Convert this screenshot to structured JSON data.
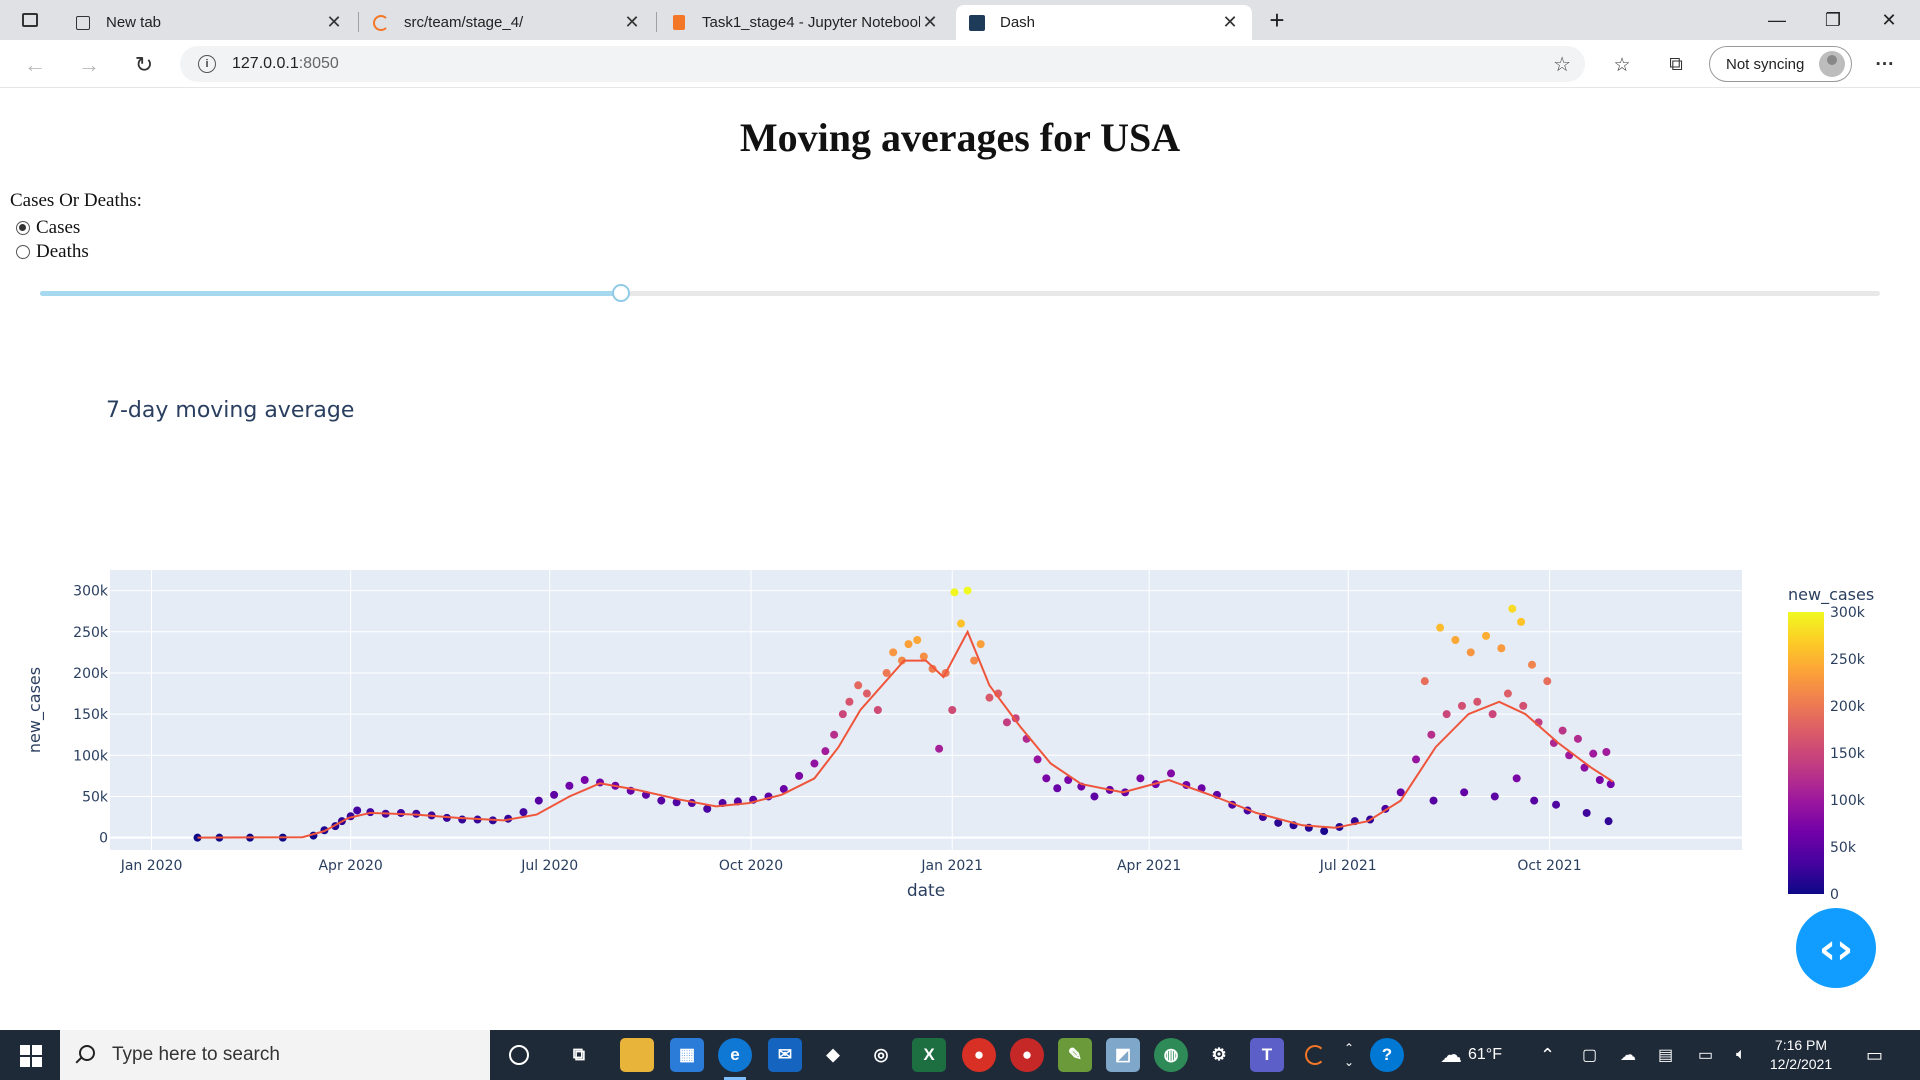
{
  "browser": {
    "tabs": [
      {
        "title": "New tab",
        "icon": "new-tab-icon"
      },
      {
        "title": "src/team/stage_4/",
        "icon": "jupyter-icon"
      },
      {
        "title": "Task1_stage4 - Jupyter Notebook",
        "icon": "notebook-icon"
      },
      {
        "title": "Dash",
        "icon": "dash-icon"
      }
    ],
    "active_tab": 3,
    "url_host": "127.0.0.1",
    "url_port": ":8050",
    "sync_label": "Not syncing"
  },
  "page": {
    "title": "Moving averages for USA",
    "radio_label": "Cases Or Deaths:",
    "options": [
      {
        "label": "Cases",
        "selected": true
      },
      {
        "label": "Deaths",
        "selected": false
      }
    ],
    "slider_fraction": 0.316,
    "chart_title": "7-day moving average"
  },
  "chart_data": {
    "type": "scatter",
    "title": "7-day moving average",
    "xlabel": "date",
    "ylabel": "new_cases",
    "x_ticks": [
      "Jan 2020",
      "Apr 2020",
      "Jul 2020",
      "Oct 2020",
      "Jan 2021",
      "Apr 2021",
      "Jul 2021",
      "Oct 2021"
    ],
    "y_ticks": [
      "0",
      "50k",
      "100k",
      "150k",
      "200k",
      "250k",
      "300k"
    ],
    "ylim": [
      -15000,
      325000
    ],
    "colorbar_title": "new_cases",
    "colorbar_ticks": [
      "0",
      "50k",
      "100k",
      "150k",
      "200k",
      "250k",
      "300k"
    ],
    "colors": {
      "line": "#ef553b",
      "plot_bg": "#e5ecf6"
    },
    "series": [
      {
        "kind": "markers",
        "points": [
          [
            "2020-01-22",
            0
          ],
          [
            "2020-02-01",
            0
          ],
          [
            "2020-02-15",
            0
          ],
          [
            "2020-03-01",
            10
          ],
          [
            "2020-03-15",
            2500
          ],
          [
            "2020-03-20",
            9000
          ],
          [
            "2020-03-25",
            14000
          ],
          [
            "2020-03-28",
            20000
          ],
          [
            "2020-04-01",
            26000
          ],
          [
            "2020-04-04",
            33000
          ],
          [
            "2020-04-10",
            31000
          ],
          [
            "2020-04-17",
            29000
          ],
          [
            "2020-04-24",
            30000
          ],
          [
            "2020-05-01",
            29000
          ],
          [
            "2020-05-08",
            27000
          ],
          [
            "2020-05-15",
            24000
          ],
          [
            "2020-05-22",
            22000
          ],
          [
            "2020-05-29",
            22000
          ],
          [
            "2020-06-05",
            21000
          ],
          [
            "2020-06-12",
            23000
          ],
          [
            "2020-06-19",
            31000
          ],
          [
            "2020-06-26",
            45000
          ],
          [
            "2020-07-03",
            52000
          ],
          [
            "2020-07-10",
            63000
          ],
          [
            "2020-07-17",
            70000
          ],
          [
            "2020-07-24",
            67000
          ],
          [
            "2020-07-31",
            63000
          ],
          [
            "2020-08-07",
            57000
          ],
          [
            "2020-08-14",
            52000
          ],
          [
            "2020-08-21",
            45000
          ],
          [
            "2020-08-28",
            43000
          ],
          [
            "2020-09-04",
            42000
          ],
          [
            "2020-09-11",
            35000
          ],
          [
            "2020-09-18",
            42000
          ],
          [
            "2020-09-25",
            44000
          ],
          [
            "2020-10-02",
            46000
          ],
          [
            "2020-10-09",
            50000
          ],
          [
            "2020-10-16",
            59000
          ],
          [
            "2020-10-23",
            75000
          ],
          [
            "2020-10-30",
            90000
          ],
          [
            "2020-11-04",
            105000
          ],
          [
            "2020-11-08",
            125000
          ],
          [
            "2020-11-12",
            150000
          ],
          [
            "2020-11-15",
            165000
          ],
          [
            "2020-11-19",
            185000
          ],
          [
            "2020-11-23",
            175000
          ],
          [
            "2020-11-28",
            155000
          ],
          [
            "2020-12-02",
            200000
          ],
          [
            "2020-12-05",
            225000
          ],
          [
            "2020-12-09",
            215000
          ],
          [
            "2020-12-12",
            235000
          ],
          [
            "2020-12-16",
            240000
          ],
          [
            "2020-12-19",
            220000
          ],
          [
            "2020-12-23",
            205000
          ],
          [
            "2020-12-26",
            108000
          ],
          [
            "2020-12-29",
            200000
          ],
          [
            "2021-01-01",
            155000
          ],
          [
            "2021-01-02",
            298000
          ],
          [
            "2021-01-05",
            260000
          ],
          [
            "2021-01-08",
            300000
          ],
          [
            "2021-01-11",
            215000
          ],
          [
            "2021-01-14",
            235000
          ],
          [
            "2021-01-18",
            170000
          ],
          [
            "2021-01-22",
            175000
          ],
          [
            "2021-01-26",
            140000
          ],
          [
            "2021-01-30",
            145000
          ],
          [
            "2021-02-04",
            120000
          ],
          [
            "2021-02-09",
            95000
          ],
          [
            "2021-02-13",
            72000
          ],
          [
            "2021-02-18",
            60000
          ],
          [
            "2021-02-23",
            70000
          ],
          [
            "2021-03-01",
            62000
          ],
          [
            "2021-03-07",
            50000
          ],
          [
            "2021-03-14",
            58000
          ],
          [
            "2021-03-21",
            55000
          ],
          [
            "2021-03-28",
            72000
          ],
          [
            "2021-04-04",
            65000
          ],
          [
            "2021-04-11",
            78000
          ],
          [
            "2021-04-18",
            64000
          ],
          [
            "2021-04-25",
            60000
          ],
          [
            "2021-05-02",
            52000
          ],
          [
            "2021-05-09",
            40000
          ],
          [
            "2021-05-16",
            33000
          ],
          [
            "2021-05-23",
            25000
          ],
          [
            "2021-05-30",
            18000
          ],
          [
            "2021-06-06",
            15000
          ],
          [
            "2021-06-13",
            12000
          ],
          [
            "2021-06-20",
            8000
          ],
          [
            "2021-06-27",
            13000
          ],
          [
            "2021-07-04",
            20000
          ],
          [
            "2021-07-11",
            22000
          ],
          [
            "2021-07-18",
            35000
          ],
          [
            "2021-07-25",
            55000
          ],
          [
            "2021-08-01",
            95000
          ],
          [
            "2021-08-08",
            125000
          ],
          [
            "2021-08-15",
            150000
          ],
          [
            "2021-08-22",
            160000
          ],
          [
            "2021-08-29",
            165000
          ],
          [
            "2021-09-05",
            150000
          ],
          [
            "2021-09-12",
            175000
          ],
          [
            "2021-09-19",
            160000
          ],
          [
            "2021-09-26",
            140000
          ],
          [
            "2021-10-03",
            115000
          ],
          [
            "2021-10-10",
            100000
          ],
          [
            "2021-10-17",
            85000
          ],
          [
            "2021-10-24",
            70000
          ],
          [
            "2021-10-29",
            65000
          ],
          [
            "2021-08-05",
            190000
          ],
          [
            "2021-08-12",
            255000
          ],
          [
            "2021-08-19",
            240000
          ],
          [
            "2021-08-26",
            225000
          ],
          [
            "2021-09-02",
            245000
          ],
          [
            "2021-09-09",
            230000
          ],
          [
            "2021-09-14",
            278000
          ],
          [
            "2021-09-18",
            262000
          ],
          [
            "2021-09-23",
            210000
          ],
          [
            "2021-09-30",
            190000
          ],
          [
            "2021-10-07",
            130000
          ],
          [
            "2021-10-14",
            120000
          ],
          [
            "2021-10-21",
            102000
          ],
          [
            "2021-10-27",
            104000
          ],
          [
            "2021-08-09",
            45000
          ],
          [
            "2021-08-23",
            55000
          ],
          [
            "2021-09-06",
            50000
          ],
          [
            "2021-09-16",
            72000
          ],
          [
            "2021-09-24",
            45000
          ],
          [
            "2021-10-04",
            40000
          ],
          [
            "2021-10-18",
            30000
          ],
          [
            "2021-10-28",
            20000
          ]
        ]
      },
      {
        "kind": "line",
        "points": [
          [
            "2020-01-22",
            0
          ],
          [
            "2020-03-10",
            500
          ],
          [
            "2020-03-20",
            8000
          ],
          [
            "2020-03-31",
            24000
          ],
          [
            "2020-04-10",
            30000
          ],
          [
            "2020-05-01",
            28000
          ],
          [
            "2020-05-20",
            24000
          ],
          [
            "2020-06-10",
            21000
          ],
          [
            "2020-06-25",
            28000
          ],
          [
            "2020-07-10",
            50000
          ],
          [
            "2020-07-24",
            66000
          ],
          [
            "2020-08-10",
            58000
          ],
          [
            "2020-08-30",
            46000
          ],
          [
            "2020-09-15",
            38000
          ],
          [
            "2020-09-30",
            42000
          ],
          [
            "2020-10-15",
            52000
          ],
          [
            "2020-10-30",
            72000
          ],
          [
            "2020-11-10",
            110000
          ],
          [
            "2020-11-20",
            155000
          ],
          [
            "2020-11-30",
            185000
          ],
          [
            "2020-12-10",
            215000
          ],
          [
            "2020-12-20",
            215000
          ],
          [
            "2020-12-28",
            195000
          ],
          [
            "2021-01-08",
            250000
          ],
          [
            "2021-01-18",
            185000
          ],
          [
            "2021-02-01",
            135000
          ],
          [
            "2021-02-15",
            90000
          ],
          [
            "2021-03-01",
            65000
          ],
          [
            "2021-03-20",
            55000
          ],
          [
            "2021-04-10",
            70000
          ],
          [
            "2021-05-01",
            50000
          ],
          [
            "2021-05-20",
            30000
          ],
          [
            "2021-06-10",
            15000
          ],
          [
            "2021-06-25",
            12000
          ],
          [
            "2021-07-10",
            20000
          ],
          [
            "2021-07-25",
            45000
          ],
          [
            "2021-08-10",
            110000
          ],
          [
            "2021-08-25",
            150000
          ],
          [
            "2021-09-08",
            165000
          ],
          [
            "2021-09-20",
            150000
          ],
          [
            "2021-10-05",
            115000
          ],
          [
            "2021-10-20",
            85000
          ],
          [
            "2021-10-30",
            68000
          ]
        ]
      }
    ]
  },
  "taskbar": {
    "search_placeholder": "Type here to search",
    "weather": "61°F",
    "time": "7:16 PM",
    "date": "12/2/2021"
  }
}
